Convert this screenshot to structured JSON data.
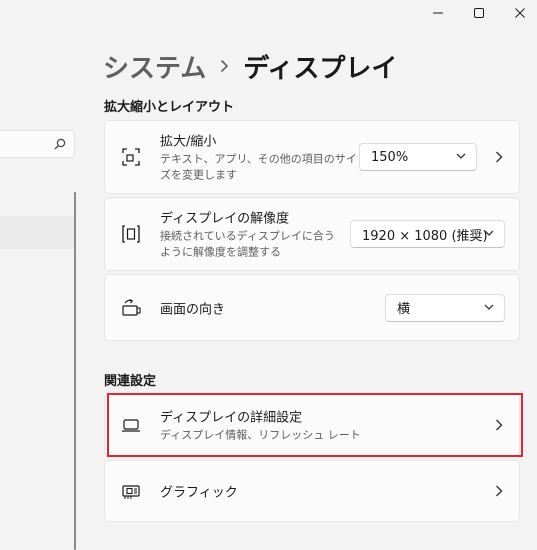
{
  "breadcrumb": {
    "parent": "システム",
    "current": "ディスプレイ"
  },
  "sections": {
    "scale_layout": "拡大縮小とレイアウト",
    "related": "関連設定"
  },
  "cards": {
    "scale": {
      "title": "拡大/縮小",
      "desc": "テキスト、アプリ、その他の項目のサイズを変更します",
      "value": "150%"
    },
    "resolution": {
      "title": "ディスプレイの解像度",
      "desc": "接続されているディスプレイに合うように解像度を調整する",
      "value": "1920 × 1080 (推奨)"
    },
    "orientation": {
      "title": "画面の向き",
      "value": "横"
    },
    "advanced": {
      "title": "ディスプレイの詳細設定",
      "desc": "ディスプレイ情報、リフレッシュ レート"
    },
    "graphics": {
      "title": "グラフィック"
    }
  },
  "icons": {
    "window": [
      "minimize-icon",
      "maximize-icon",
      "close-icon"
    ],
    "search": "search-icon",
    "scale": "scale-icon",
    "resolution": "resolution-icon",
    "orientation": "orientation-icon",
    "advanced": "laptop-icon",
    "graphics": "graphics-card-icon"
  },
  "colors": {
    "highlight": "#e0262f",
    "background": "#f3f3f3",
    "card": "#fbfbfb"
  }
}
